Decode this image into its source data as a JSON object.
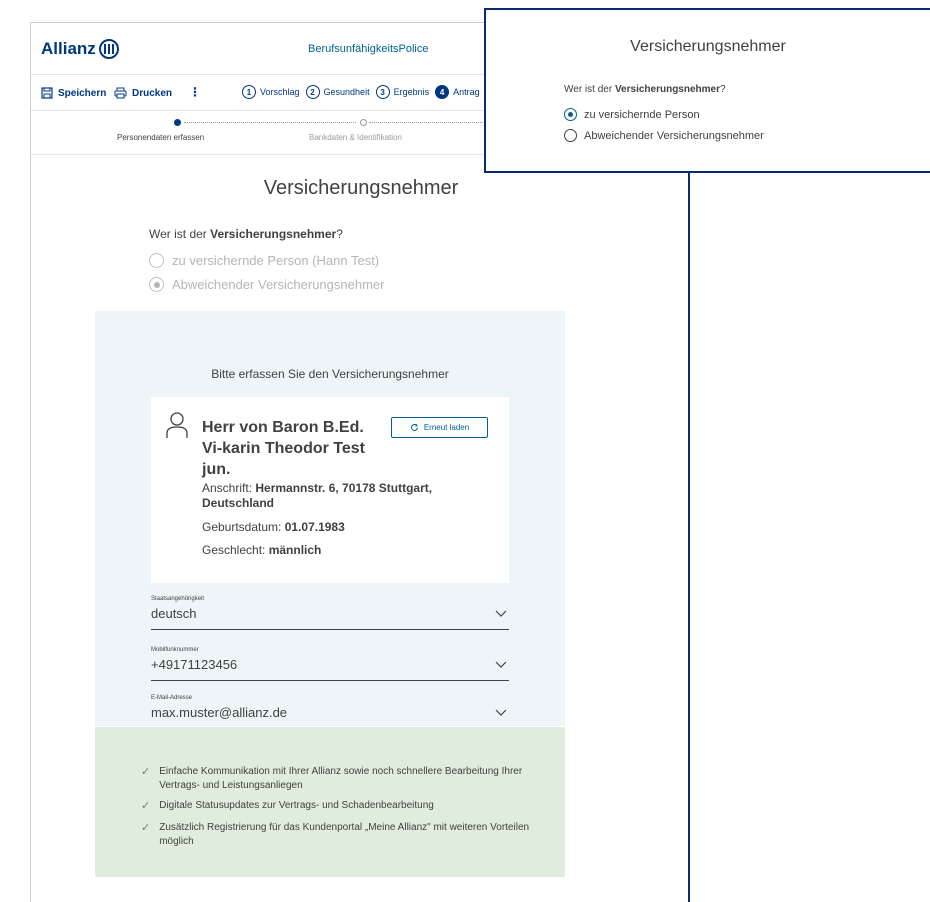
{
  "header": {
    "logo_text": "Allianz",
    "product_title": "BerufsunfähigkeitsPolice"
  },
  "toolbar": {
    "save_label": "Speichern",
    "print_label": "Drucken",
    "more_label": "⋮",
    "steps": [
      {
        "num": "1",
        "label": "Vorschlag"
      },
      {
        "num": "2",
        "label": "Gesundheit"
      },
      {
        "num": "3",
        "label": "Ergebnis"
      },
      {
        "num": "4",
        "label": "Antrag"
      }
    ]
  },
  "progress": {
    "step1_label": "Personendaten erfassen",
    "step2_label": "Bankdaten & Identifikation"
  },
  "main": {
    "title": "Versicherungsnehmer",
    "question_prefix": "Wer ist der ",
    "question_bold": "Versicherungsnehmer",
    "question_suffix": "?",
    "option_1": "zu versichernde Person (Hann Test)",
    "option_2": "Abweichender Versicherungsnehmer",
    "selected_option": 2
  },
  "form": {
    "heading": "Bitte erfassen Sie den Versicherungsnehmer",
    "person": {
      "name": "Herr von Baron B.Ed. Vi-karin Theodor Test jun.",
      "reload_label": "Erneut laden",
      "address_label": "Anschrift: ",
      "address_value": "Hermannstr. 6, 70178 Stuttgart, Deutschland",
      "birthdate_label": "Geburtsdatum: ",
      "birthdate_value": "01.07.1983",
      "gender_label": "Geschlecht: ",
      "gender_value": "männlich"
    },
    "fields": [
      {
        "label": "Staatsangehörigkeit",
        "value": "deutsch"
      },
      {
        "label": "Mobilfunknummer",
        "value": "+49171123456"
      },
      {
        "label": "E-Mail-Adresse",
        "value": "max.muster@allianz.de"
      }
    ]
  },
  "benefits": [
    "Einfache Kommunikation mit Ihrer Allianz sowie noch schnellere Bearbeitung Ihrer Vertrags- und Leistungsanliegen",
    "Digitale Statusupdates zur Vertrags- und Schadenbearbeitung",
    "Zusätzlich Registrierung für das Kundenportal „Meine Allianz\" mit weiteren Vorteilen möglich"
  ],
  "popup": {
    "title": "Versicherungsnehmer",
    "question_prefix": "Wer ist der ",
    "question_bold": "Versicherungsnehmer",
    "question_suffix": "?",
    "option_1": "zu versichernde Person",
    "option_2": "Abweichender Versicherungsnehmer",
    "selected_option": 1
  },
  "colors": {
    "brand": "#003781",
    "accent": "#006192",
    "form_bg": "#eef5f8",
    "benefits_bg": "#e0eddc"
  }
}
